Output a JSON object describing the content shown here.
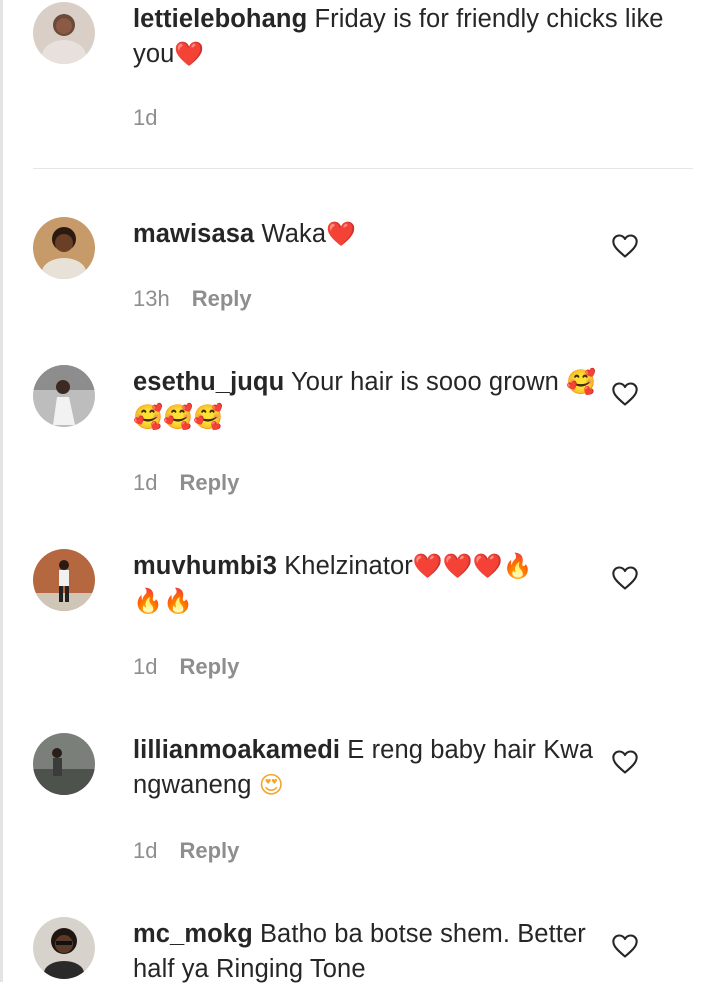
{
  "comments": [
    {
      "username": "lettielebohang",
      "text": "Friday is for friendly chicks like you",
      "emoji": "❤️",
      "time": "1d",
      "reply": "",
      "avatar_icon": "profile-photo"
    },
    {
      "username": "mawisasa",
      "text": "Waka",
      "emoji": "❤️",
      "time": "13h",
      "reply": "Reply",
      "avatar_icon": "profile-photo"
    },
    {
      "username": "esethu_juqu",
      "text": "Your hair is sooo grown",
      "emoji": "🥰🥰🥰🥰",
      "time": "1d",
      "reply": "Reply",
      "avatar_icon": "profile-photo"
    },
    {
      "username": "muvhumbi3",
      "text": "Khelzinator",
      "emoji": "❤️❤️❤️🔥",
      "emoji2": "🔥🔥",
      "time": "1d",
      "reply": "Reply",
      "avatar_icon": "profile-photo"
    },
    {
      "username": "lillianmoakamedi",
      "text": "E reng baby hair Kwa ngwaneng",
      "emoji": "😍",
      "time": "1d",
      "reply": "Reply",
      "avatar_icon": "profile-photo"
    },
    {
      "username": "mc_mokg",
      "text": "Batho ba botse shem. Better half ya Ringing Tone",
      "time": "",
      "reply": "",
      "avatar_icon": "profile-photo"
    }
  ],
  "icons": {
    "like": "heart-outline-icon"
  },
  "colors": {
    "username": "#262626",
    "meta": "#8e8e8e",
    "heart": "#e0245e",
    "divider": "#e6e6e6"
  }
}
